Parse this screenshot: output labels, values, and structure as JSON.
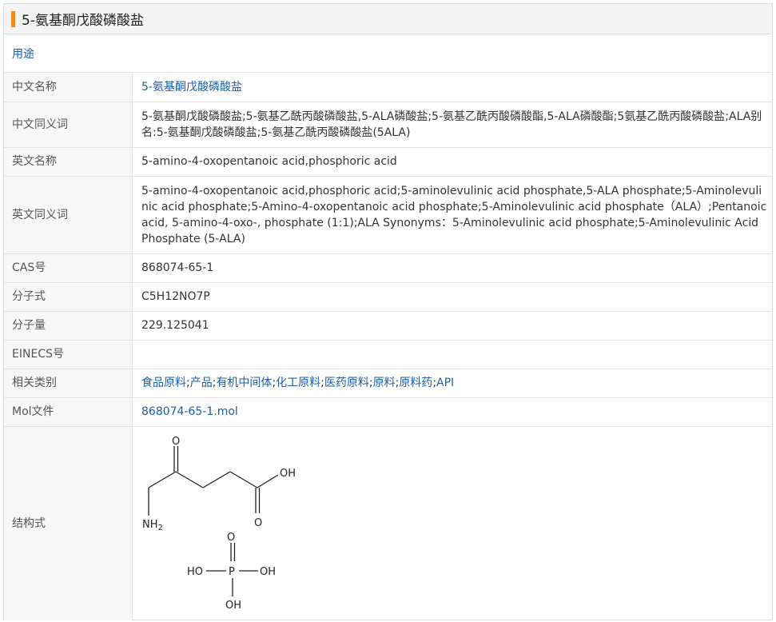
{
  "page": {
    "title": "5-氨基酮戊酸磷酸盐",
    "usage_link": "用途"
  },
  "rows": {
    "cn_name": {
      "label": "中文名称",
      "value": "5-氨基酮戊酸磷酸盐"
    },
    "cn_synonyms": {
      "label": "中文同义词",
      "value": "5-氨基酮戊酸磷酸盐;5-氨基乙酰丙酸磷酸盐,5-ALA磷酸盐;5-氨基乙酰丙酸磷酸酯,5-ALA磷酸酯;5氨基乙酰丙酸磷酸盐;ALA别名:5-氨基酮戊酸磷酸盐;5-氨基乙酰丙酸磷酸盐(5ALA)"
    },
    "en_name": {
      "label": "英文名称",
      "value": "5-amino-4-oxopentanoic acid,phosphoric acid"
    },
    "en_synonyms": {
      "label": "英文同义词",
      "value": "5-amino-4-oxopentanoic acid,phosphoric acid;5-aminolevulinic acid phosphate,5-ALA phosphate;5-Aminolevulinic acid phosphate;5-Amino-4-oxopentanoic acid phosphate;5-Aminolevulinic acid phosphate（ALA）;Pentanoic acid, 5-amino-4-oxo-, phosphate (1:1);ALA Synonyms：5-Aminolevulinic acid phosphate;5-Aminolevulinic Acid Phosphate (5-ALA)"
    },
    "cas": {
      "label": "CAS号",
      "value": "868074-65-1"
    },
    "formula": {
      "label": "分子式",
      "value": "C5H12NO7P"
    },
    "mw": {
      "label": "分子量",
      "value": "229.125041"
    },
    "einecs": {
      "label": "EINECS号",
      "value": ""
    },
    "categories": {
      "label": "相关类别",
      "items": [
        "食品原料",
        "产品",
        "有机中间体",
        "化工原料",
        "医药原料",
        "原料",
        "原料药",
        "API"
      ],
      "separator": ";"
    },
    "mol": {
      "label": "Mol文件",
      "value": "868074-65-1.mol"
    },
    "structure": {
      "label": "结构式",
      "atoms": {
        "o_top": "O",
        "oh_acid": "OH",
        "o_acid": "O",
        "nh2_n": "NH",
        "nh2_sub": "2",
        "p": "P",
        "p_o": "O",
        "p_ho_left": "HO",
        "p_oh_right": "OH",
        "p_oh_bottom": "OH"
      }
    }
  }
}
